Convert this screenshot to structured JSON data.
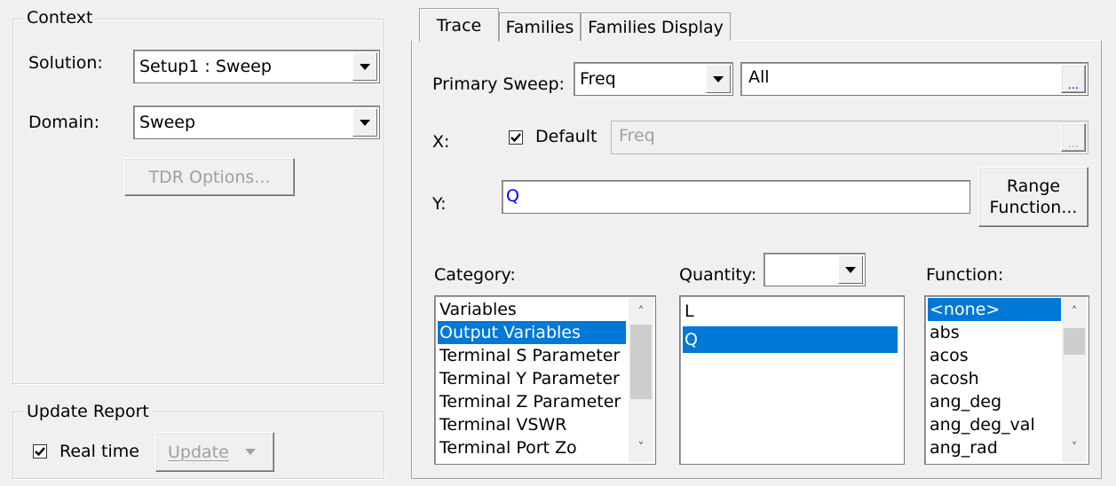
{
  "context": {
    "legend": "Context",
    "solution_label": "Solution:",
    "solution_value": "Setup1 : Sweep",
    "domain_label": "Domain:",
    "domain_value": "Sweep",
    "tdr_button": "TDR Options..."
  },
  "update_report": {
    "legend": "Update Report",
    "realtime_label": "Real time",
    "realtime_checked": true,
    "update_button": "Update"
  },
  "tabs": [
    {
      "label": "Trace",
      "active": true
    },
    {
      "label": "Families",
      "active": false
    },
    {
      "label": "Families Display",
      "active": false
    }
  ],
  "trace": {
    "primary_sweep_label": "Primary Sweep:",
    "primary_sweep_value": "Freq",
    "sweep_range_value": "All",
    "ellipsis": "...",
    "x_label": "X:",
    "x_default_label": "Default",
    "x_default_checked": true,
    "x_value": "Freq",
    "y_label": "Y:",
    "y_value": "Q",
    "range_function_button": {
      "line1": "Range",
      "line2": "Function..."
    },
    "category_label": "Category:",
    "category_items": [
      "Variables",
      "Output Variables",
      "Terminal S Parameter",
      "Terminal Y Parameter",
      "Terminal Z Parameter",
      "Terminal VSWR",
      "Terminal Port Zo"
    ],
    "category_selected": 1,
    "quantity_label": "Quantity:",
    "quantity_filter_value": "",
    "quantity_items": [
      "L",
      "Q"
    ],
    "quantity_selected": 1,
    "function_label": "Function:",
    "function_items": [
      "<none>",
      "abs",
      "acos",
      "acosh",
      "ang_deg",
      "ang_deg_val",
      "ang_rad"
    ],
    "function_selected": 0
  },
  "colors": {
    "selection": "#0078d7",
    "y_text": "#0000ff",
    "background": "#f0f0f0"
  }
}
